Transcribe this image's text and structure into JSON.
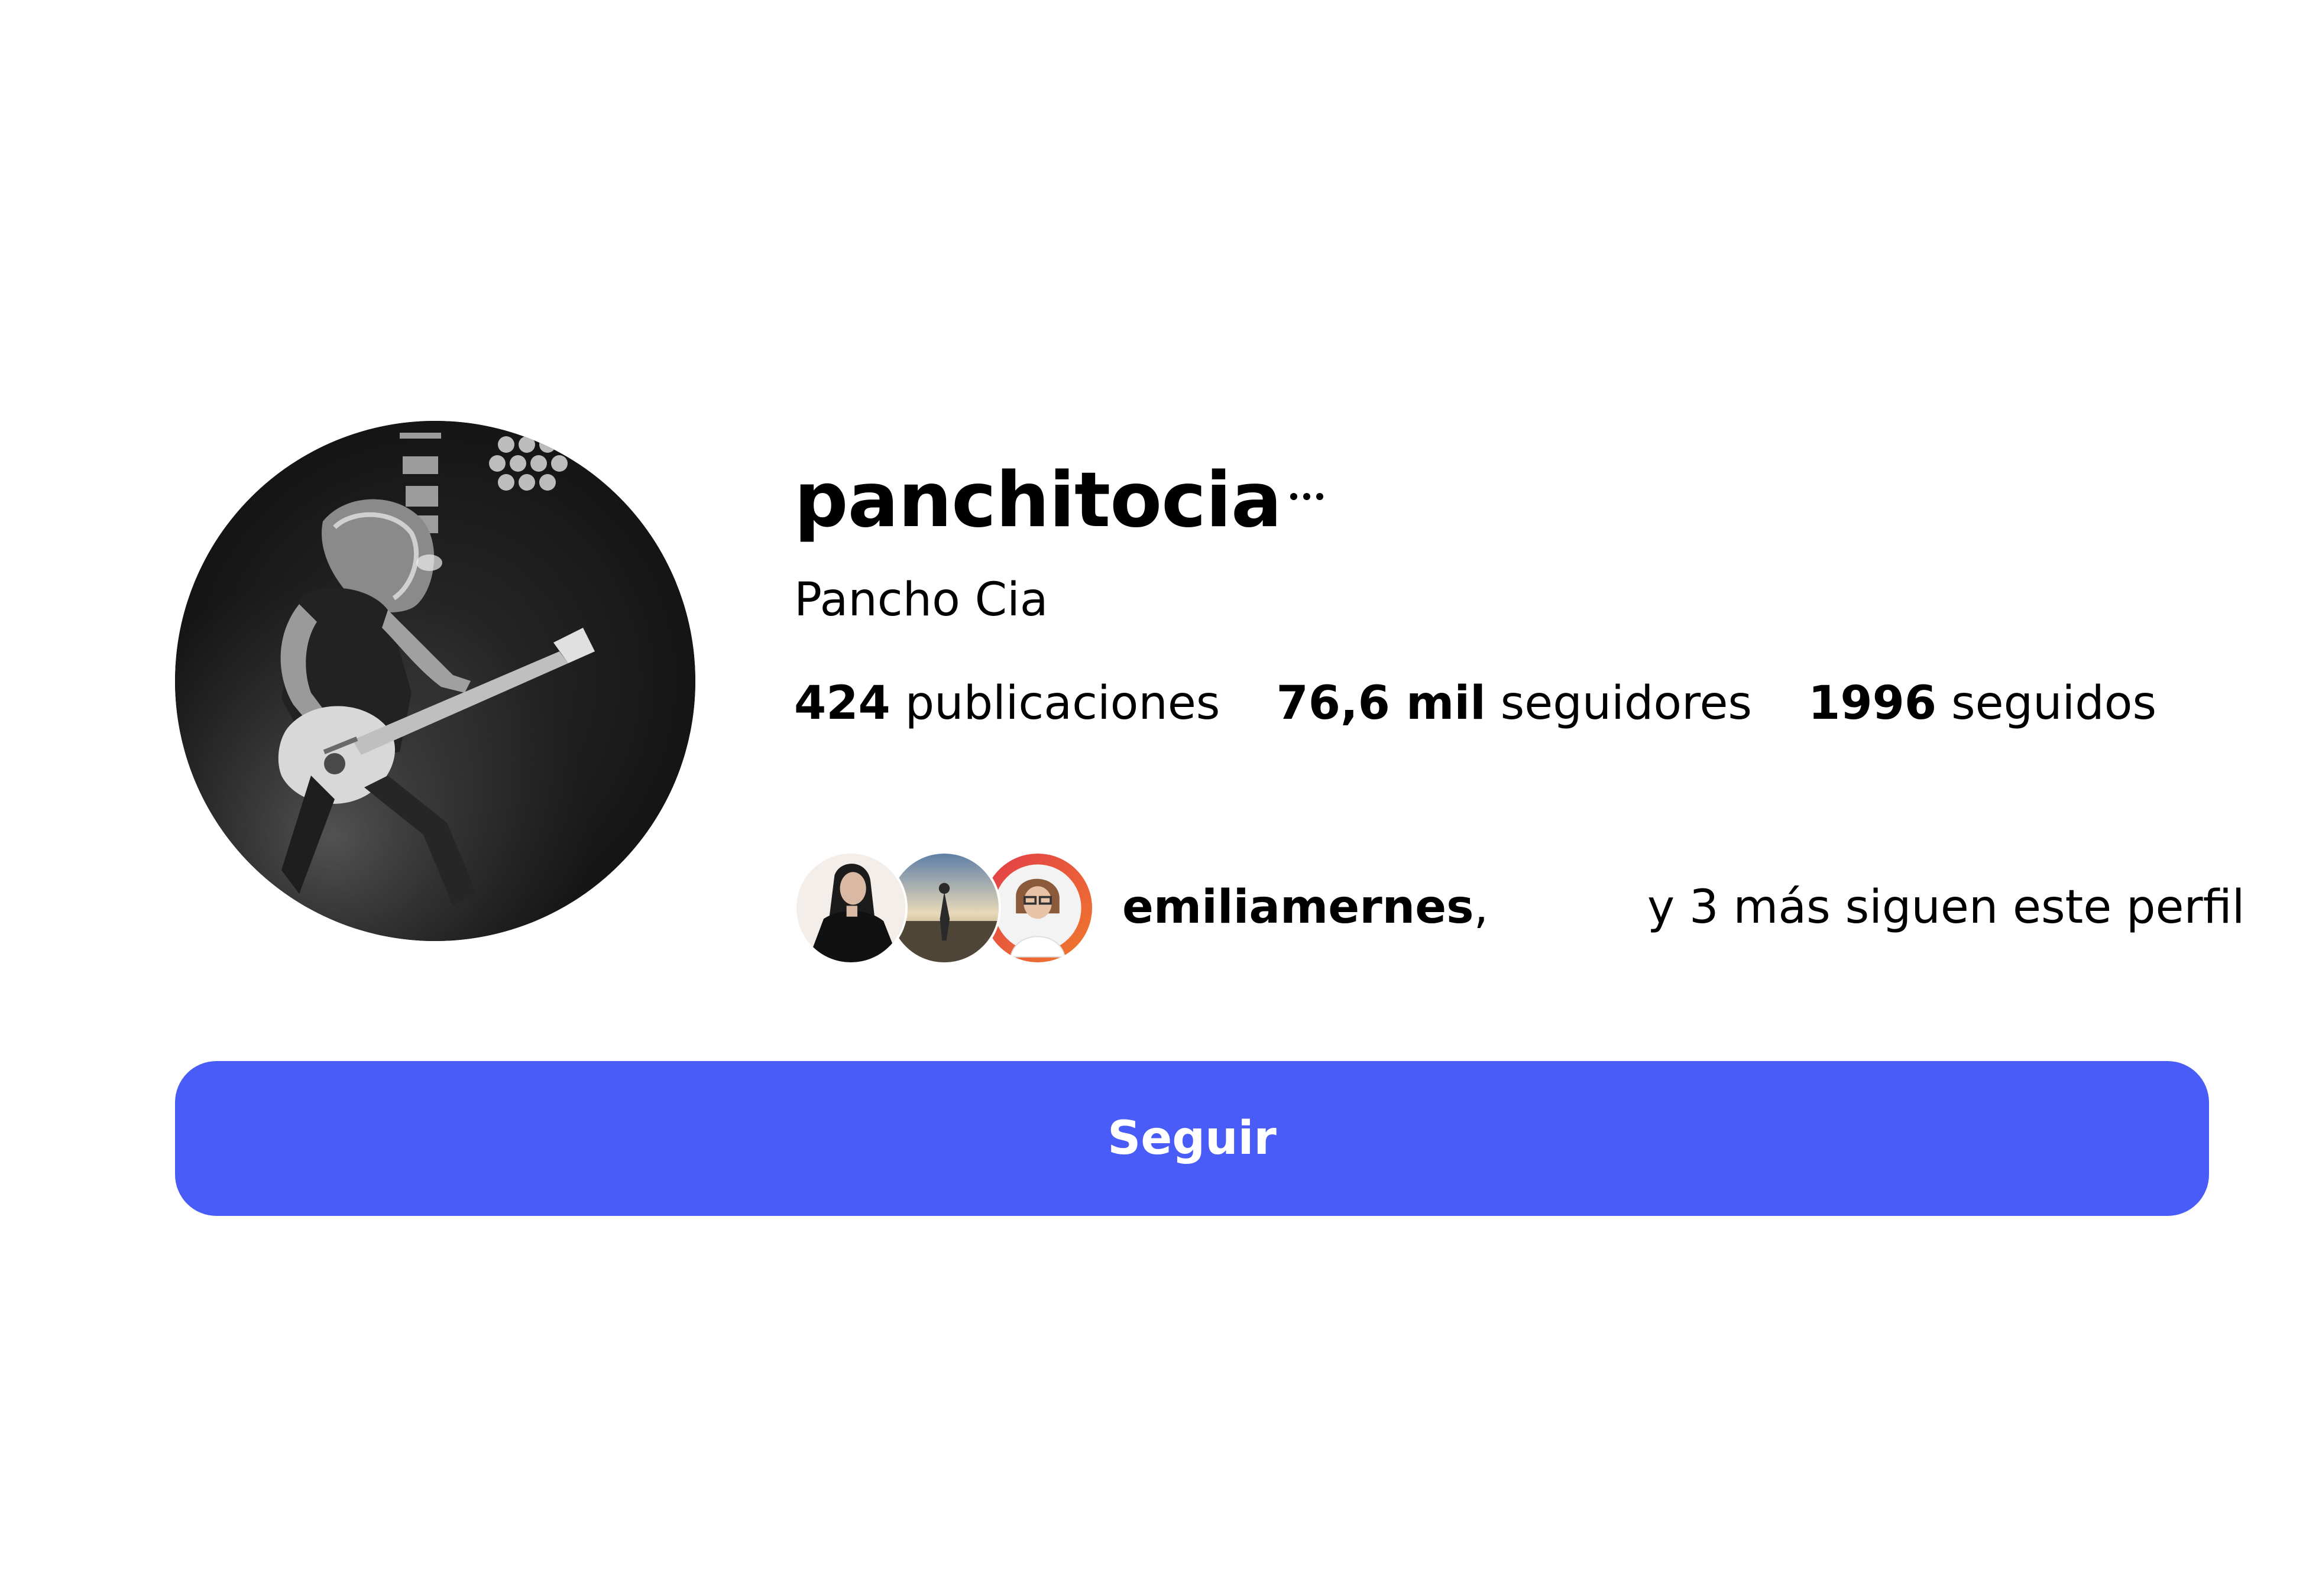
{
  "profile": {
    "username": "panchitocia",
    "full_name": "Pancho Cia",
    "more_options_icon": "ellipsis-icon"
  },
  "stats": {
    "posts_count": "424",
    "posts_label": "publicaciones",
    "followers_count": "76,6 mil",
    "followers_label": "seguidores",
    "following_count": "1996",
    "following_label": "seguidos"
  },
  "followed_by": {
    "username": "emiliamernes",
    "separator": ",",
    "rest_text": "y 3 más siguen este perfil"
  },
  "actions": {
    "follow_label": "Seguir"
  },
  "colors": {
    "follow_button": "#4a5cf7",
    "text": "#000000",
    "background": "#ffffff"
  }
}
